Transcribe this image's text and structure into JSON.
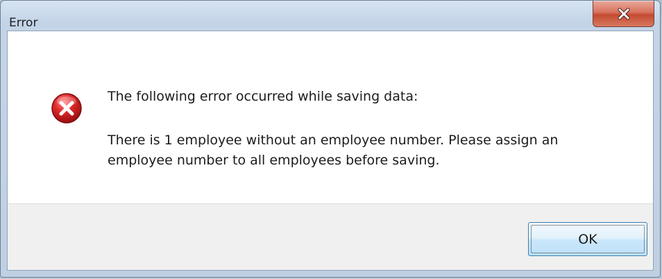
{
  "dialog": {
    "title": "Error",
    "close_icon": "close-x-icon",
    "status_icon": "error-circle-x-icon",
    "message_heading": "The following error occurred while saving data:",
    "message_detail": "There is 1 employee without an employee number. Please assign an employee number to all employees before saving.",
    "ok_label": "OK"
  },
  "colors": {
    "close_button": "#c44a31",
    "error_icon": "#c8102e",
    "ok_button_border": "#3c7fb1",
    "title_bar": "#bfd0e3"
  }
}
